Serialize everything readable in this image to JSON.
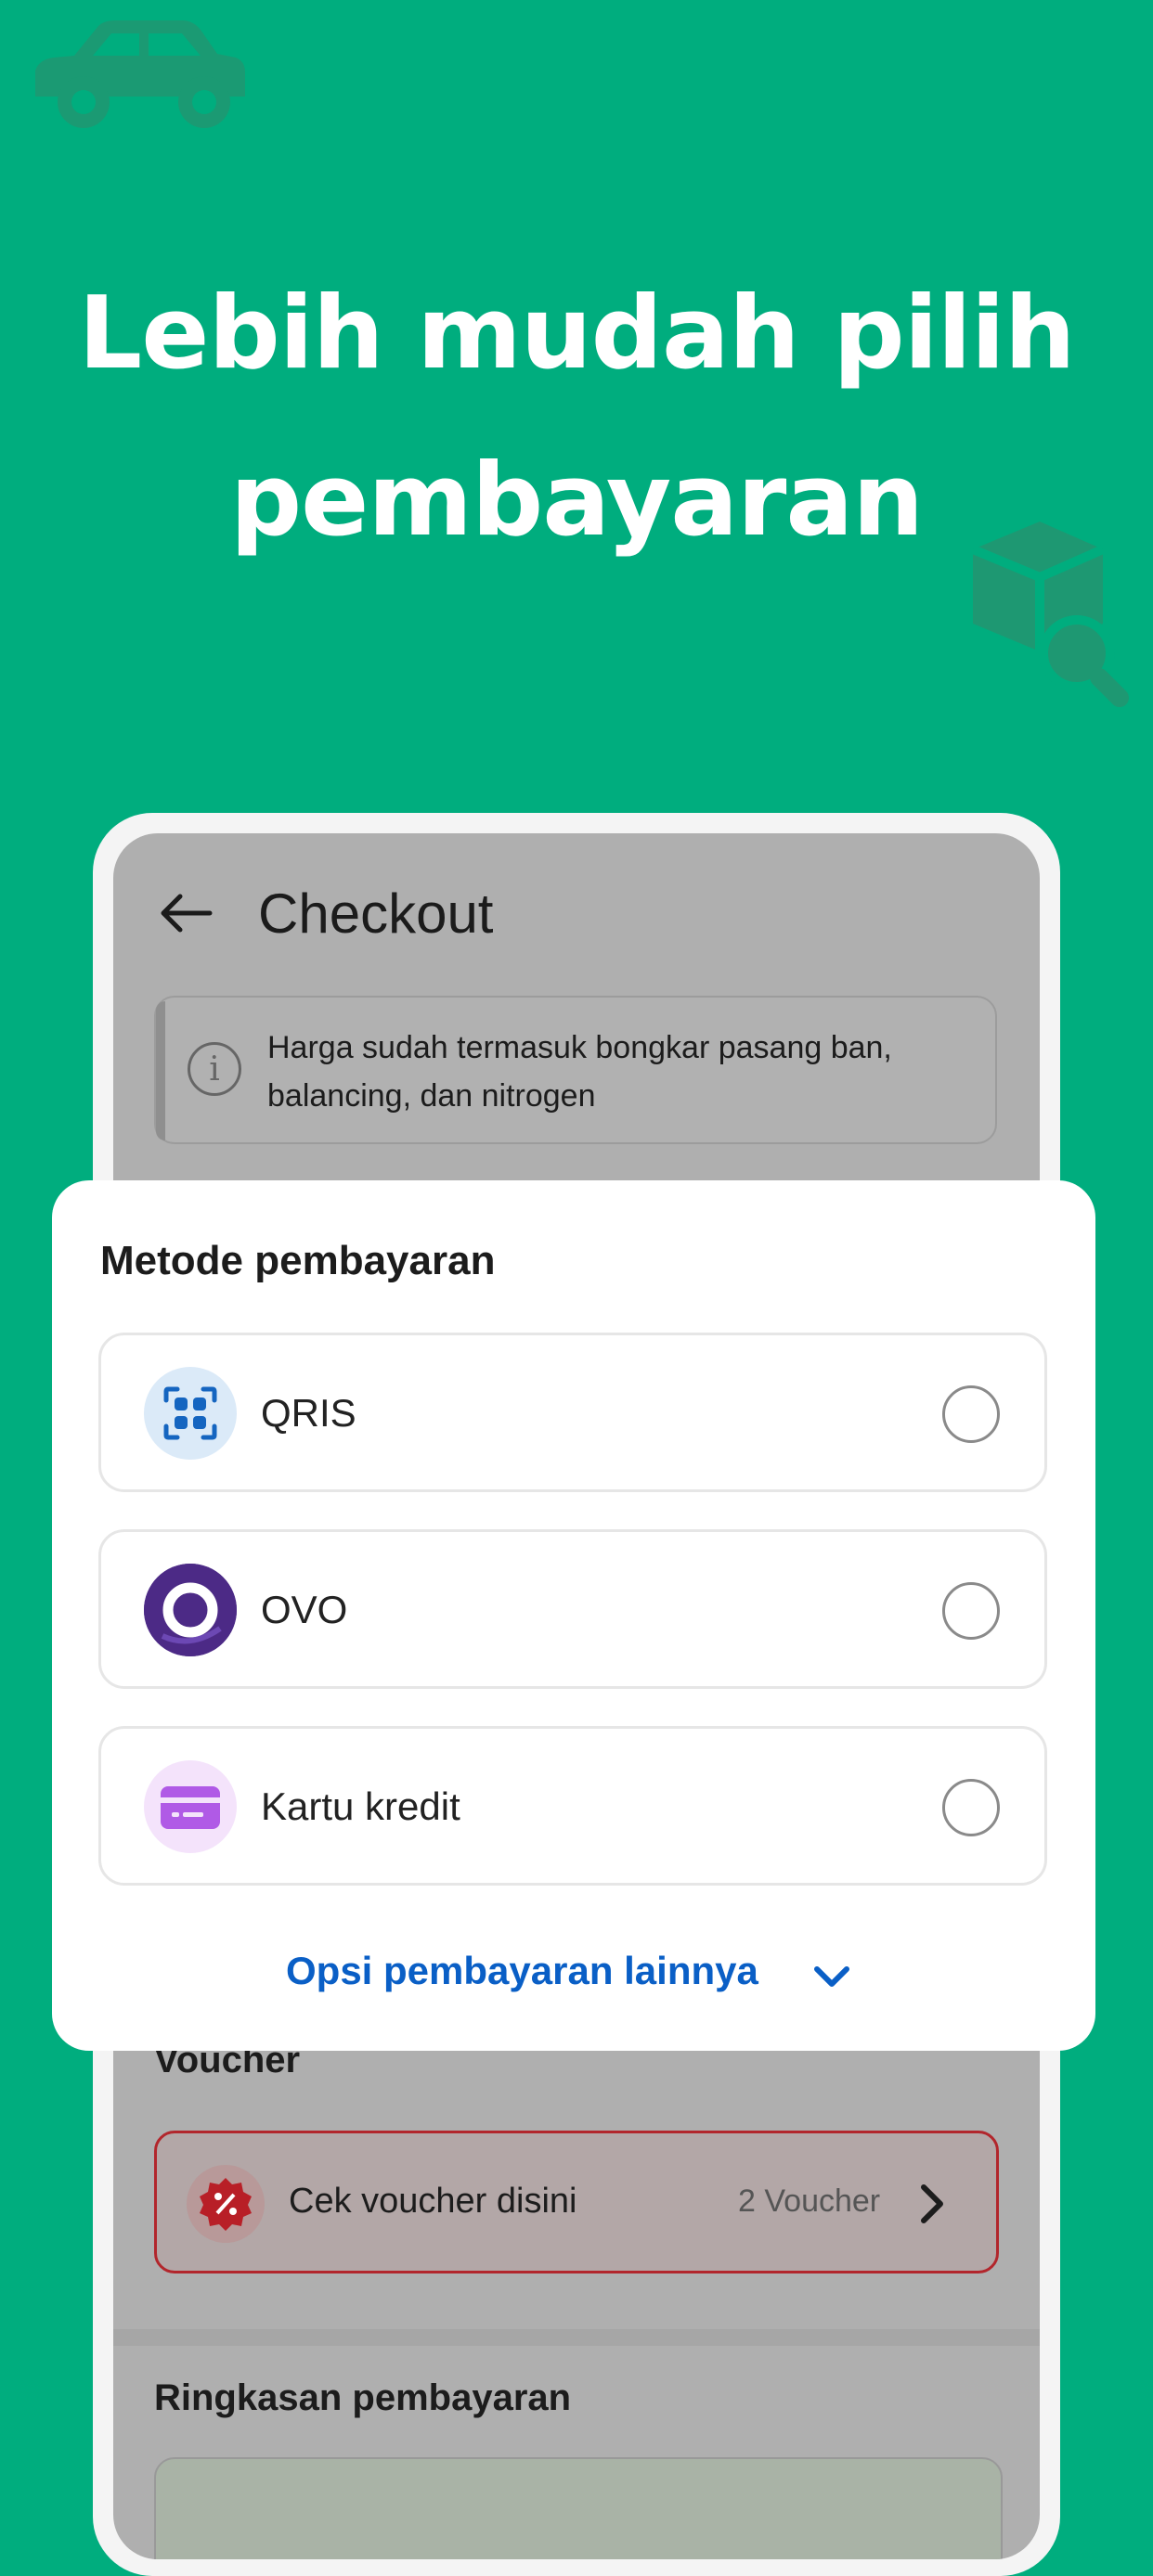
{
  "headline": {
    "line1": "Lebih mudah pilih",
    "line2": "pembayaran"
  },
  "screen": {
    "title": "Checkout",
    "info_text": "Harga sudah termasuk bongkar pasang ban, balancing, dan nitrogen",
    "voucher": {
      "title": "Voucher",
      "cta": "Cek voucher disini",
      "count": "2 Voucher"
    },
    "summary": {
      "title": "Ringkasan pembayaran"
    }
  },
  "sheet": {
    "title": "Metode pembayaran",
    "options": [
      {
        "label": "QRIS",
        "icon": "qris-icon"
      },
      {
        "label": "OVO",
        "icon": "ovo-icon"
      },
      {
        "label": "Kartu kredit",
        "icon": "credit-card-icon"
      }
    ],
    "more_label": "Opsi pembayaran lainnya"
  },
  "colors": {
    "background": "#00AD7E",
    "link": "#0A5FC6",
    "voucher_border": "#B2262C"
  }
}
